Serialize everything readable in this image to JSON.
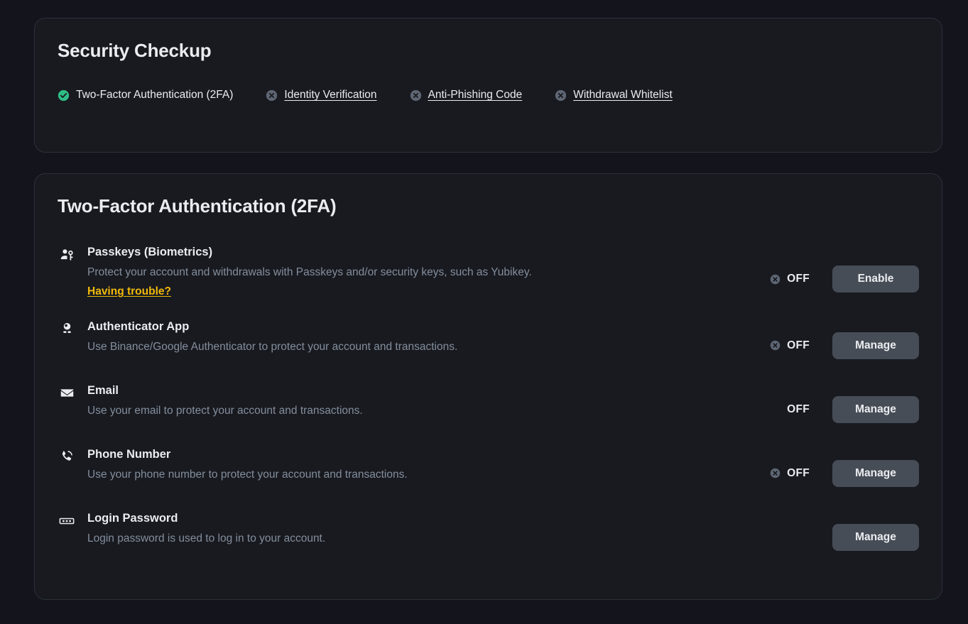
{
  "checkup": {
    "title": "Security Checkup",
    "items": [
      {
        "label": "Two-Factor Authentication (2FA)",
        "status": "done",
        "icon": "check-circle-icon"
      },
      {
        "label": "Identity Verification",
        "status": "pending",
        "icon": "x-circle-icon"
      },
      {
        "label": "Anti-Phishing Code",
        "status": "pending",
        "icon": "x-circle-icon"
      },
      {
        "label": "Withdrawal Whitelist",
        "status": "pending",
        "icon": "x-circle-icon"
      }
    ]
  },
  "twofa": {
    "title": "Two-Factor Authentication (2FA)",
    "methods": [
      {
        "name": "Passkeys (Biometrics)",
        "description": "Protect your account and withdrawals with Passkeys and/or security keys, such as Yubikey.",
        "link": "Having trouble?",
        "status": "OFF",
        "has_status_icon": true,
        "action": "Enable",
        "icon": "passkey-person-icon"
      },
      {
        "name": "Authenticator App",
        "description": "Use Binance/Google Authenticator to protect your account and transactions.",
        "link": "",
        "status": "OFF",
        "has_status_icon": true,
        "action": "Manage",
        "icon": "authenticator-icon"
      },
      {
        "name": "Email",
        "description": "Use your email to protect your account and transactions.",
        "link": "",
        "status": "OFF",
        "has_status_icon": false,
        "action": "Manage",
        "icon": "envelope-icon"
      },
      {
        "name": "Phone Number",
        "description": "Use your phone number to protect your account and transactions.",
        "link": "",
        "status": "OFF",
        "has_status_icon": true,
        "action": "Manage",
        "icon": "phone-icon"
      },
      {
        "name": "Login Password",
        "description": "Login password is used to log in to your account.",
        "link": "",
        "status": "",
        "has_status_icon": false,
        "action": "Manage",
        "icon": "password-dots-icon"
      }
    ]
  },
  "colors": {
    "page_background": "#14151c",
    "card_background": "#181a20",
    "card_border": "#2b3139",
    "text_primary": "#eaecef",
    "text_secondary": "#848e9c",
    "accent_link": "#f0b90b",
    "status_success": "#2ebd85",
    "status_off": "#5e6673",
    "button_fill": "#474d57"
  }
}
